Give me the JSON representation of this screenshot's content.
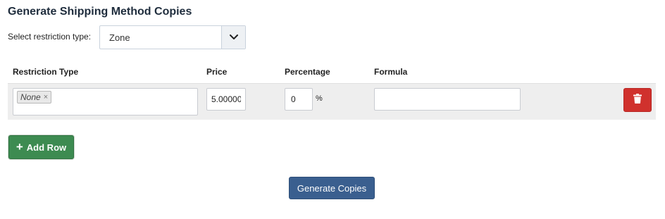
{
  "page": {
    "title": "Generate Shipping Method Copies"
  },
  "restriction": {
    "label": "Select restriction type:",
    "selected": "Zone"
  },
  "table": {
    "headers": [
      "Restriction Type",
      "Price",
      "Percentage",
      "Formula"
    ],
    "rows": [
      {
        "restriction_tags": [
          "None"
        ],
        "price": "5.000000",
        "percentage": "0",
        "percentage_unit": "%",
        "formula": ""
      }
    ]
  },
  "buttons": {
    "add_row_label": "Add Row",
    "generate_label": "Generate Copies"
  },
  "icons": {
    "select_caret": "chevron-down-icon",
    "delete": "trash-icon",
    "add": "plus-icon",
    "tag_remove": "close-icon"
  },
  "colors": {
    "delete_button": "#d0312d",
    "add_button": "#3d8b51",
    "generate_button": "#3a5f8f"
  }
}
